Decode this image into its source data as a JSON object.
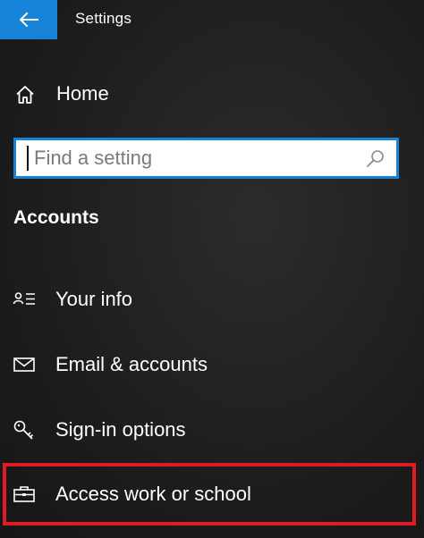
{
  "window": {
    "title": "Settings",
    "accent_color": "#1683d8"
  },
  "home": {
    "label": "Home",
    "icon": "home-icon"
  },
  "search": {
    "placeholder": "Find a setting",
    "value": "",
    "icon": "search-icon"
  },
  "section": {
    "heading": "Accounts"
  },
  "nav": {
    "items": [
      {
        "label": "Your info",
        "icon": "person-info-icon"
      },
      {
        "label": "Email & accounts",
        "icon": "mail-icon"
      },
      {
        "label": "Sign-in options",
        "icon": "key-icon"
      },
      {
        "label": "Access work or school",
        "icon": "briefcase-icon"
      }
    ]
  },
  "annotation": {
    "highlight_color": "#e01b24",
    "highlighted_item": "Access work or school"
  }
}
